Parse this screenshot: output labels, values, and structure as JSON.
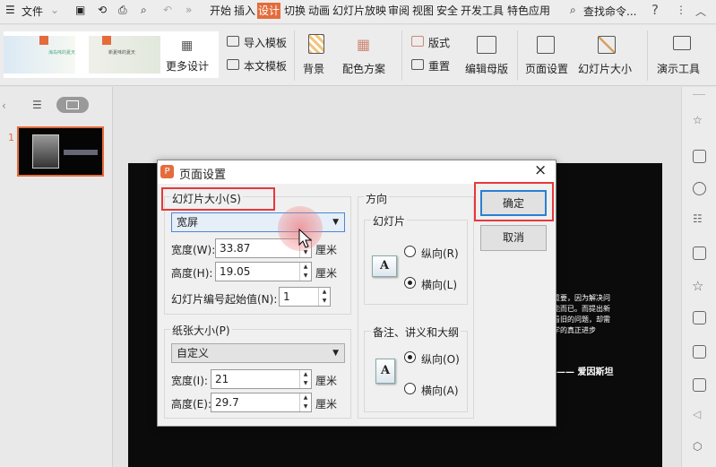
{
  "topbar": {
    "menu": "文件",
    "tabs": [
      "开始",
      "插入",
      "设计",
      "切换",
      "动画",
      "幻灯片放映",
      "审阅",
      "视图",
      "安全",
      "开发工具",
      "特色应用"
    ],
    "active_tab": "设计",
    "search": "查找命令...",
    "help": "?"
  },
  "ribbon": {
    "templates": [
      "海岛味的夏天",
      "新夏味的夏天"
    ],
    "more_design": "更多设计",
    "import_template": "导入模板",
    "text_template": "本文模板",
    "background": "背景",
    "color_scheme": "配色方案",
    "layout": "版式",
    "reset": "重置",
    "edit_master": "编辑母版",
    "page_setup": "页面设置",
    "slide_size": "幻灯片大小",
    "present_tools": "演示工具"
  },
  "slides_panel": {
    "slide_number": "1"
  },
  "slide": {
    "quote_lines": [
      "重要，因为解决问",
      "能而已。而提出新",
      "看旧的问题，却需",
      "学的真正进步"
    ],
    "author": "—— 爱因斯坦"
  },
  "dialog": {
    "title": "页面设置",
    "close": "×",
    "slide_size": {
      "label": "幻灯片大小(S)",
      "preset": "宽屏",
      "width_label": "宽度(W):",
      "width": "33.87",
      "height_label": "高度(H):",
      "height": "19.05",
      "unit": "厘米",
      "start_label": "幻灯片编号起始值(N):",
      "start": "1"
    },
    "paper_size": {
      "label": "纸张大小(P)",
      "preset": "自定义",
      "width_label": "宽度(I):",
      "width": "21",
      "height_label": "高度(E):",
      "height": "29.7",
      "unit": "厘米"
    },
    "orientation": {
      "label": "方向",
      "slides_label": "幻灯片",
      "portrait": "纵向(R)",
      "landscape": "横向(L)",
      "slides_selected": "landscape",
      "notes_label": "备注、讲义和大纲",
      "notes_portrait": "纵向(O)",
      "notes_landscape": "横向(A)",
      "notes_selected": "portrait"
    },
    "ok": "确定",
    "cancel": "取消"
  },
  "colors": {
    "accent": "#e46c3c",
    "highlight": "#e8373a"
  }
}
